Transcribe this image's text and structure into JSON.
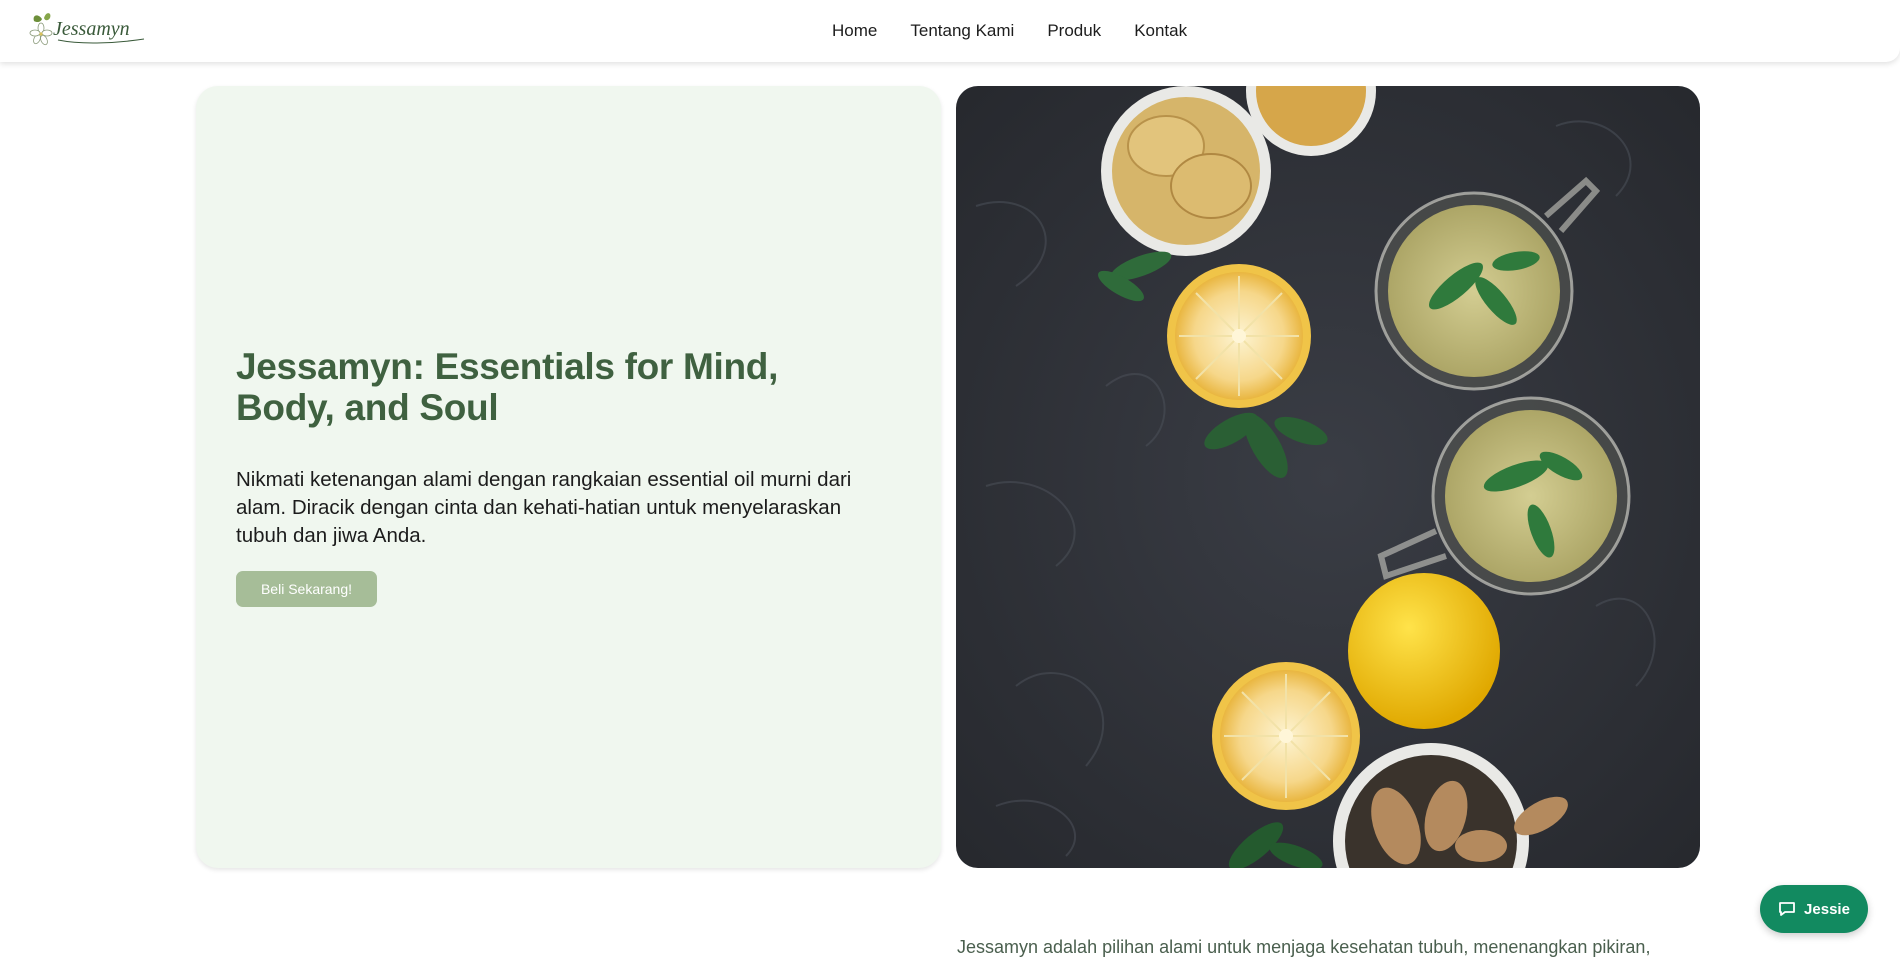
{
  "brand": {
    "name": "Jessamyn"
  },
  "nav": {
    "items": [
      {
        "label": "Home"
      },
      {
        "label": "Tentang Kami"
      },
      {
        "label": "Produk"
      },
      {
        "label": "Kontak"
      }
    ]
  },
  "hero": {
    "title": "Jessamyn: Essentials for Mind, Body, and Soul",
    "description": "Nikmati ketenangan alami dengan rangkaian essential oil murni dari alam. Diracik dengan cinta dan kehati-hatian untuk menyelaraskan tubuh dan jiwa Anda.",
    "cta_label": "Beli Sekarang!",
    "image_icon": "lemon-ginger-tea-photo"
  },
  "about": {
    "text": "Jessamyn adalah pilihan alami untuk menjaga kesehatan tubuh, menenangkan pikiran,"
  },
  "chat": {
    "label": "Jessie",
    "icon": "chat-bubble-icon"
  },
  "colors": {
    "brand_green": "#3f6140",
    "hero_bg": "#f0f7ef",
    "cta_bg": "#a6bd98",
    "chat_bg": "#128a60"
  }
}
